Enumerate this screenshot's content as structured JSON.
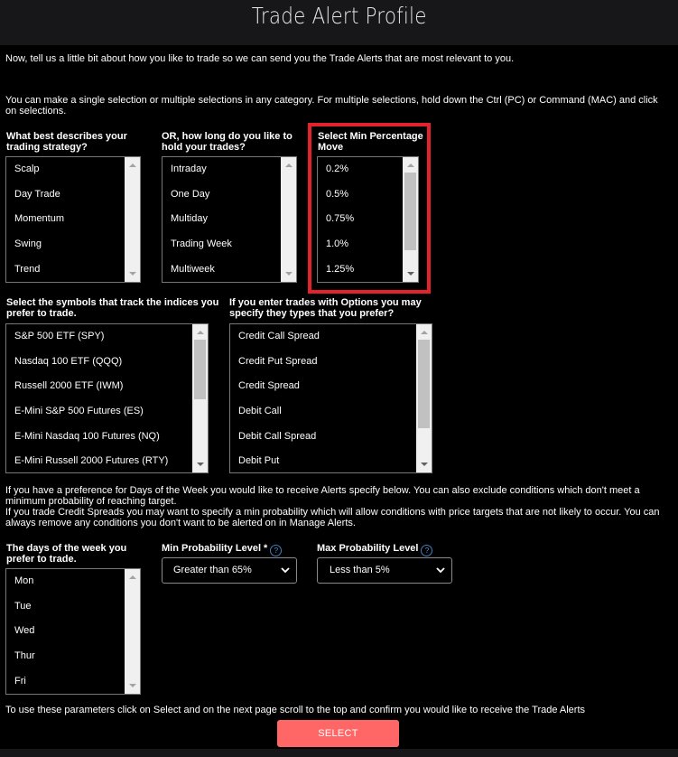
{
  "header": {
    "title": "Trade Alert Profile"
  },
  "intro": {
    "line1": "Now, tell us a little bit about how you like to trade so we can send you the Trade Alerts that are most relevant to you.",
    "line2": "You can make a single selection or multiple selections in any category.  For multiple selections, hold down the Ctrl (PC) or Command (MAC) and click on selections."
  },
  "strategy": {
    "label": "What best describes your trading strategy?",
    "options": [
      "Scalp",
      "Day Trade",
      "Momentum",
      "Swing",
      "Trend"
    ]
  },
  "hold": {
    "label": "OR, how long do you like to hold your trades?",
    "options": [
      "Intraday",
      "One Day",
      "Multiday",
      "Trading Week",
      "Multiweek"
    ]
  },
  "min_move": {
    "label": "Select Min Percentage Move",
    "options": [
      "0.2%",
      "0.5%",
      "0.75%",
      "1.0%",
      "1.25%"
    ],
    "highlight_color": "#e3222b"
  },
  "symbols": {
    "label": "Select the symbols that track the indices you prefer to trade.",
    "options": [
      "S&P 500 ETF (SPY)",
      "Nasdaq 100 ETF (QQQ)",
      "Russell 2000 ETF (IWM)",
      "E-Mini S&P 500 Futures (ES)",
      "E-Mini Nasdaq 100 Futures (NQ)",
      "E-Mini Russell 2000 Futures (RTY)"
    ]
  },
  "option_types": {
    "label": "If you enter trades with Options you may specify they types that you prefer?",
    "options": [
      "Credit Call Spread",
      "Credit Put Spread",
      "Credit Spread",
      "Debit Call",
      "Debit Call Spread",
      "Debit Put"
    ]
  },
  "info": {
    "line1": "If you have a preference for Days of the Week you would like to receive Alerts specify below.  You can also exclude conditions which don't meet a minimum probability of reaching target.",
    "line2": "If you trade Credit Spreads you may want to specify a  min probability which will allow conditions with price targets that are not likely to occur.  You can always remove any conditions you don't want to be alerted on in Manage Alerts."
  },
  "days": {
    "label": "The days of the week you prefer to trade.",
    "options": [
      "Mon",
      "Tue",
      "Wed",
      "Thur",
      "Fri"
    ]
  },
  "min_prob": {
    "label": "Min Probability Level",
    "required_mark": "*",
    "help_glyph": "?",
    "value": "Greater than 65%"
  },
  "max_prob": {
    "label": "Max Probability Level",
    "help_glyph": "?",
    "value": "Less than 5%"
  },
  "footer": {
    "instruction": "To use these parameters click on Select and on the next page scroll to the top and confirm you would like to receive the Trade Alerts",
    "select_label": "SELECT",
    "button_color": "#ff6767"
  }
}
